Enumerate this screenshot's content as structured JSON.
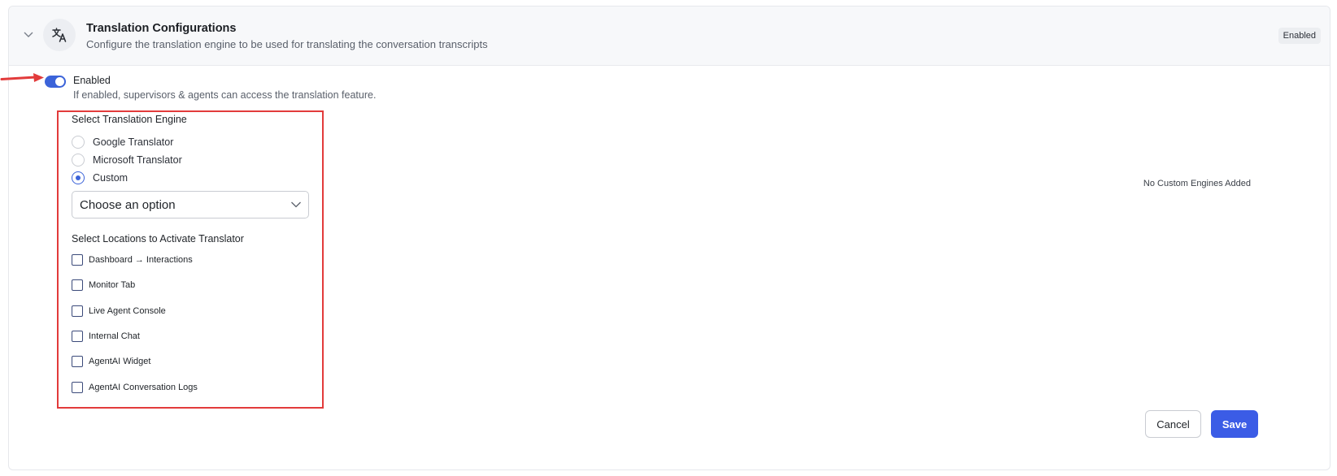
{
  "header": {
    "title": "Translation Configurations",
    "description": "Configure the translation engine to be used for translating the conversation transcripts",
    "status_badge": "Enabled"
  },
  "toggle": {
    "label": "Enabled",
    "description": "If enabled, supervisors & agents can access the translation feature.",
    "on": true
  },
  "engine": {
    "section_label": "Select Translation Engine",
    "options": [
      {
        "label": "Google Translator",
        "selected": false
      },
      {
        "label": "Microsoft Translator",
        "selected": false
      },
      {
        "label": "Custom",
        "selected": true
      }
    ],
    "dropdown_value": "Choose an option",
    "custom_engines_note": "No Custom Engines Added"
  },
  "locations": {
    "section_label": "Select Locations to Activate Translator",
    "items": [
      {
        "label": "Dashboard → Interactions",
        "checked": false
      },
      {
        "label": "Monitor Tab",
        "checked": false
      },
      {
        "label": "Live Agent Console",
        "checked": false
      },
      {
        "label": "Internal Chat",
        "checked": false
      },
      {
        "label": "AgentAI Widget",
        "checked": false
      },
      {
        "label": "AgentAI Conversation Logs",
        "checked": false
      }
    ]
  },
  "actions": {
    "cancel_label": "Cancel",
    "save_label": "Save"
  },
  "icons": [
    "chevron-down-icon",
    "translate-icon",
    "red-arrow-annotation"
  ],
  "colors": {
    "accent": "#3b63d9",
    "save_button": "#3b5ce6",
    "highlight_annotation": "#e23b3b"
  }
}
